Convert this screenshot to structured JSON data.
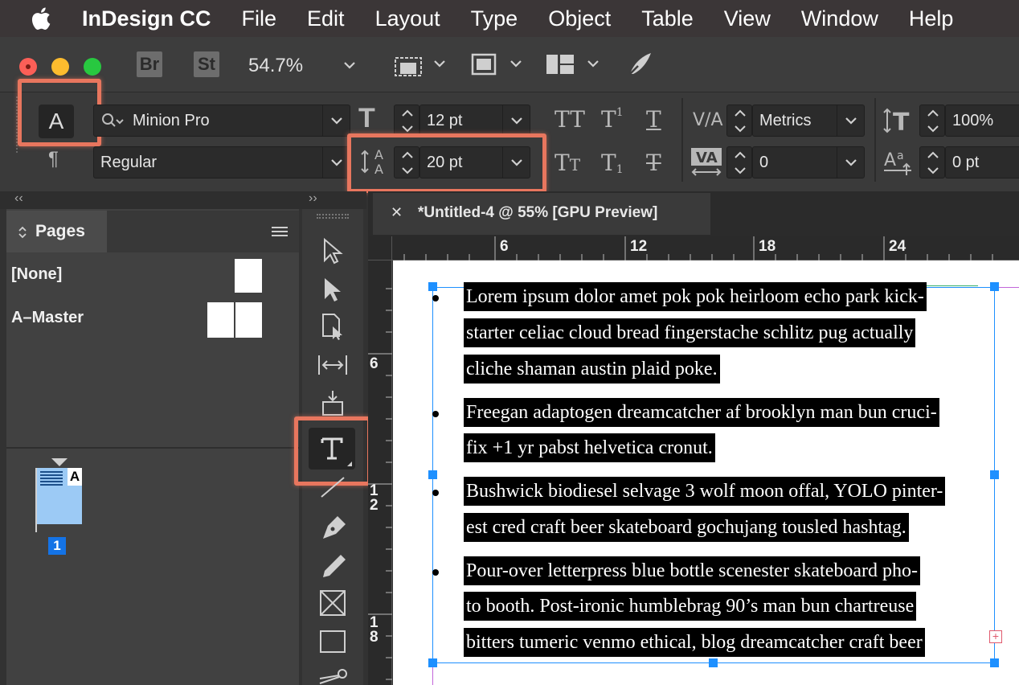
{
  "menubar": {
    "app_name": "InDesign CC",
    "items": [
      "File",
      "Edit",
      "Layout",
      "Type",
      "Object",
      "Table",
      "View",
      "Window",
      "Help"
    ]
  },
  "appbar": {
    "bridge_badge": "Br",
    "stock_badge": "St",
    "zoom": "54.7%",
    "icons": [
      "view-options-icon",
      "screen-mode-icon",
      "arrange-documents-icon",
      "publish-online-icon"
    ]
  },
  "control_panel": {
    "char_mode_letter": "A",
    "para_mode_symbol": "¶",
    "font_family": "Minion Pro",
    "font_style": "Regular",
    "font_size": "12 pt",
    "leading": "20 pt",
    "kerning": "Metrics",
    "tracking": "0",
    "vertical_scale": "100%",
    "baseline_shift": "0 pt"
  },
  "panels": {
    "collapse_left": "‹‹",
    "collapse_right": "››",
    "pages_tab": "Pages",
    "none_label": "[None]",
    "master_label": "A–Master",
    "page_thumb_master": "A",
    "page_number": "1"
  },
  "document": {
    "tab_title": "*Untitled-4 @ 55% [GPU Preview]",
    "close_symbol": "✕",
    "ruler_top": [
      "6",
      "12",
      "18",
      "24"
    ],
    "ruler_left": [
      "6",
      "1\n2",
      "1\n8"
    ],
    "paragraphs": [
      [
        "Lorem ipsum dolor amet pok pok heirloom echo park kick-",
        "starter celiac cloud bread fingerstache schlitz pug actually",
        "cliche shaman austin plaid poke."
      ],
      [
        "Freegan adaptogen dreamcatcher af brooklyn man bun cruci-",
        "fix +1 yr pabst helvetica cronut."
      ],
      [
        "Bushwick biodiesel selvage 3 wolf moon offal, YOLO pinter-",
        "est cred craft beer skateboard gochujang tousled hashtag."
      ],
      [
        "Pour-over letterpress blue bottle scenester skateboard pho-",
        "to booth. Post-ironic humblebrag 90’s man bun chartreuse",
        "bitters tumeric venmo ethical, blog dreamcatcher craft beer"
      ]
    ]
  },
  "colors": {
    "highlight": "#e8765e",
    "selection_blue": "#1e90ff",
    "page_badge": "#1473e6"
  }
}
